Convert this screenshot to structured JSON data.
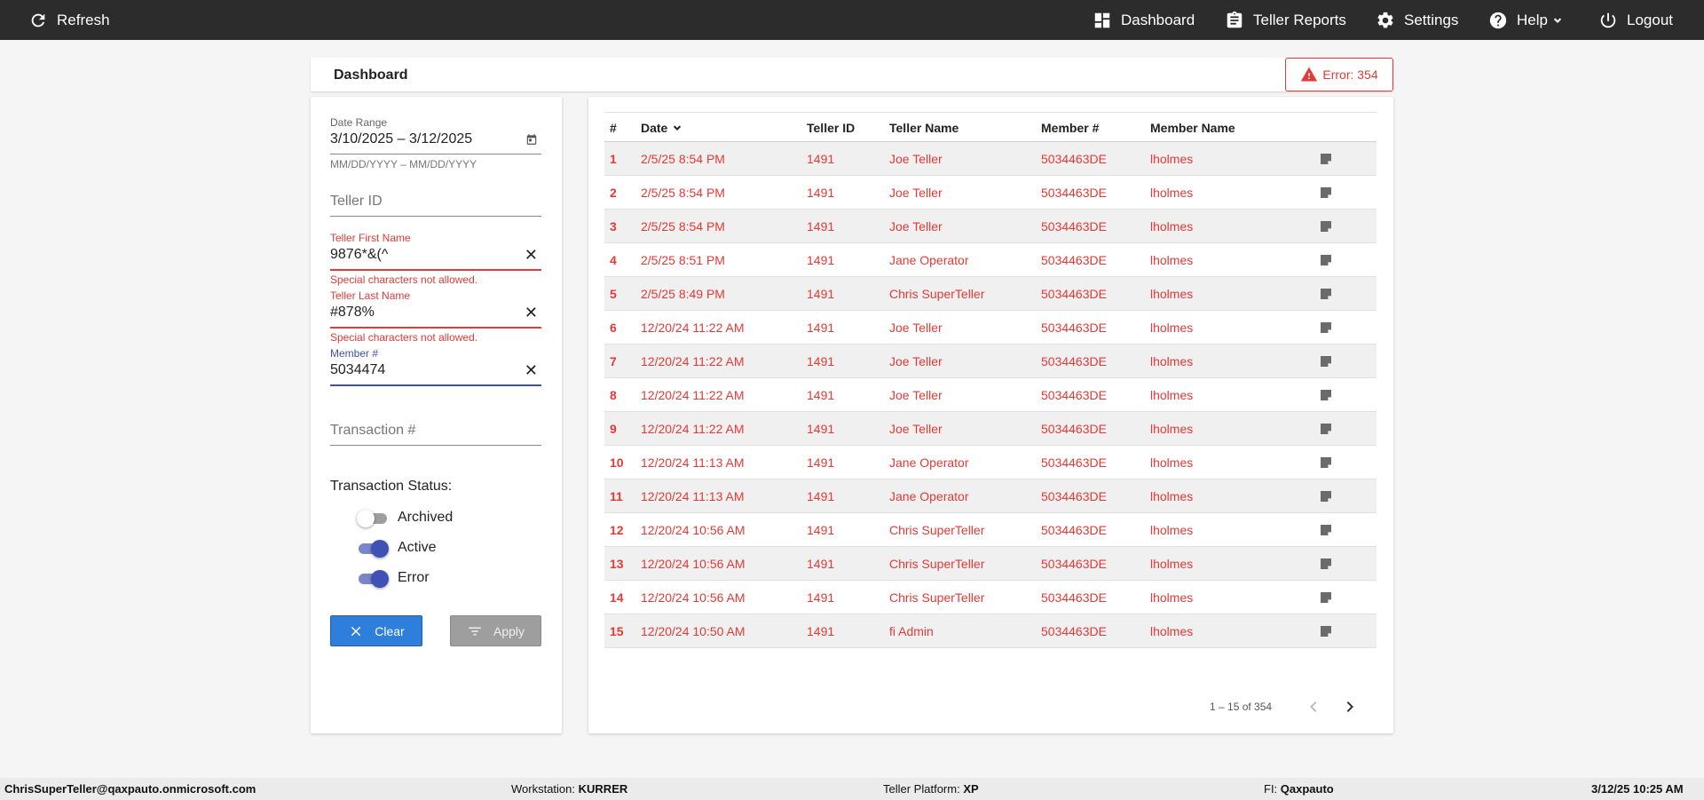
{
  "topbar": {
    "refresh_label": "Refresh",
    "nav": {
      "dashboard": "Dashboard",
      "teller_reports": "Teller Reports",
      "settings": "Settings",
      "help": "Help",
      "logout": "Logout"
    }
  },
  "header": {
    "title": "Dashboard",
    "error_badge": "Error: 354"
  },
  "filters": {
    "date_range": {
      "label": "Date Range",
      "value": "3/10/2025 – 3/12/2025",
      "hint": "MM/DD/YYYY – MM/DD/YYYY"
    },
    "teller_id": {
      "placeholder": "Teller ID",
      "value": ""
    },
    "teller_first_name": {
      "label": "Teller First Name",
      "value": "9876*&(^",
      "error": "Special characters not allowed."
    },
    "teller_last_name": {
      "label": "Teller Last Name",
      "value": "#878%",
      "error": "Special characters not allowed."
    },
    "member_number": {
      "label": "Member #",
      "value": "5034474"
    },
    "transaction_number": {
      "placeholder": "Transaction #",
      "value": ""
    },
    "status_title": "Transaction Status:",
    "statuses": [
      {
        "label": "Archived",
        "checked": false
      },
      {
        "label": "Active",
        "checked": true
      },
      {
        "label": "Error",
        "checked": true
      }
    ],
    "clear_label": "Clear",
    "apply_label": "Apply"
  },
  "table": {
    "columns": [
      "#",
      "Date",
      "Teller ID",
      "Teller Name",
      "Member #",
      "Member Name"
    ],
    "rows": [
      [
        "1",
        "2/5/25 8:54 PM",
        "1491",
        "Joe Teller",
        "5034463DE",
        "lholmes"
      ],
      [
        "2",
        "2/5/25 8:54 PM",
        "1491",
        "Joe Teller",
        "5034463DE",
        "lholmes"
      ],
      [
        "3",
        "2/5/25 8:54 PM",
        "1491",
        "Joe Teller",
        "5034463DE",
        "lholmes"
      ],
      [
        "4",
        "2/5/25 8:51 PM",
        "1491",
        "Jane Operator",
        "5034463DE",
        "lholmes"
      ],
      [
        "5",
        "2/5/25 8:49 PM",
        "1491",
        "Chris SuperTeller",
        "5034463DE",
        "lholmes"
      ],
      [
        "6",
        "12/20/24 11:22 AM",
        "1491",
        "Joe Teller",
        "5034463DE",
        "lholmes"
      ],
      [
        "7",
        "12/20/24 11:22 AM",
        "1491",
        "Joe Teller",
        "5034463DE",
        "lholmes"
      ],
      [
        "8",
        "12/20/24 11:22 AM",
        "1491",
        "Joe Teller",
        "5034463DE",
        "lholmes"
      ],
      [
        "9",
        "12/20/24 11:22 AM",
        "1491",
        "Joe Teller",
        "5034463DE",
        "lholmes"
      ],
      [
        "10",
        "12/20/24 11:13 AM",
        "1491",
        "Jane Operator",
        "5034463DE",
        "lholmes"
      ],
      [
        "11",
        "12/20/24 11:13 AM",
        "1491",
        "Jane Operator",
        "5034463DE",
        "lholmes"
      ],
      [
        "12",
        "12/20/24 10:56 AM",
        "1491",
        "Chris SuperTeller",
        "5034463DE",
        "lholmes"
      ],
      [
        "13",
        "12/20/24 10:56 AM",
        "1491",
        "Chris SuperTeller",
        "5034463DE",
        "lholmes"
      ],
      [
        "14",
        "12/20/24 10:56 AM",
        "1491",
        "Chris SuperTeller",
        "5034463DE",
        "lholmes"
      ],
      [
        "15",
        "12/20/24 10:50 AM",
        "1491",
        "fi Admin",
        "5034463DE",
        "lholmes"
      ]
    ],
    "row_color": "#e53935",
    "pager_text": "1 – 15 of 354"
  },
  "footer": {
    "user": "ChrisSuperTeller@qaxpauto.onmicrosoft.com",
    "workstation_label": "Workstation:",
    "workstation": "KURRER",
    "platform_label": "Teller Platform:",
    "platform": "XP",
    "fi_label": "FI:",
    "fi": "Qaxpauto",
    "datetime": "3/12/25 10:25 AM"
  }
}
